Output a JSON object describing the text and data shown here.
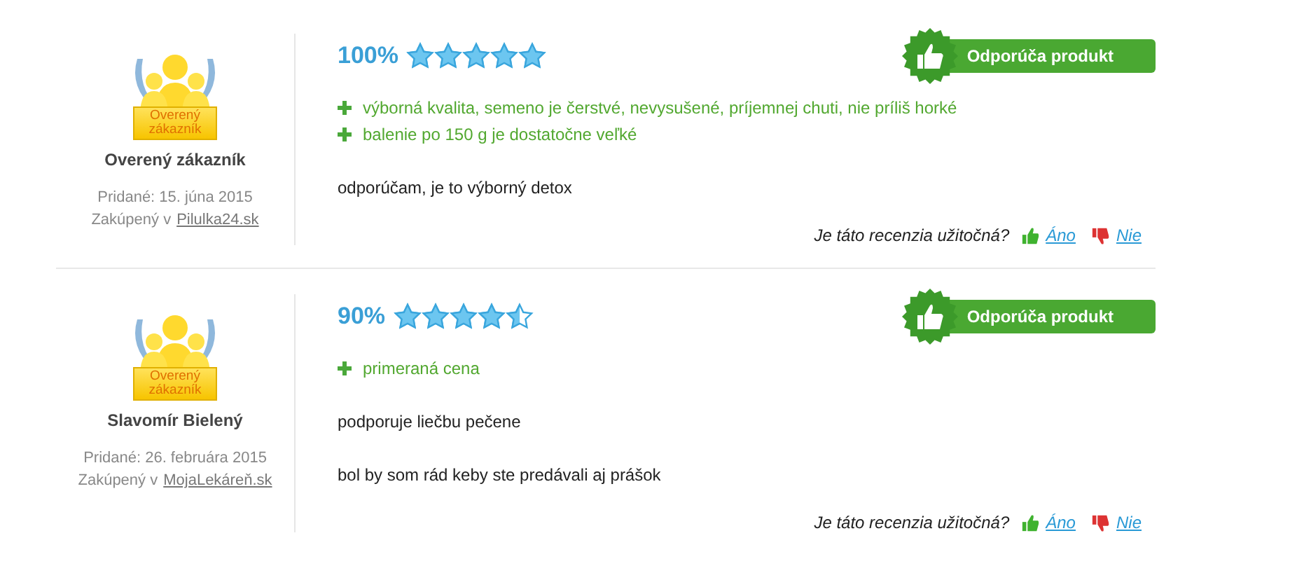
{
  "reviews": [
    {
      "badge": [
        "Overený",
        "zákazník"
      ],
      "author": "Overený zákazník",
      "added": "Pridané: 15. júna 2015",
      "purchased": "Zakúpený v",
      "shop": "Pilulka24.sk",
      "percent": "100%",
      "stars": 5,
      "recommend": "Odporúča produkt",
      "pros": [
        "výborná kvalita, semeno je čerstvé, nevysušené, príjemnej chuti, nie príliš horké",
        "balenie po 150 g je dostatočne veľké"
      ],
      "paragraphs": [
        "odporúčam, je to výborný detox"
      ],
      "helpful": "Je táto recenzia užitočná?",
      "yes": "Áno",
      "no": "Nie"
    },
    {
      "badge": [
        "Overený",
        "zákazník"
      ],
      "author": "Slavomír Bielený",
      "added": "Pridané: 26. februára 2015",
      "purchased": "Zakúpený v",
      "shop": "MojaLekáreň.sk",
      "percent": "90%",
      "stars": 4.5,
      "recommend": "Odporúča produkt",
      "pros": [
        "primeraná cena"
      ],
      "paragraphs": [
        "podporuje liečbu pečene",
        "bol by som rád keby ste predávali aj prášok"
      ],
      "helpful": "Je táto recenzia užitočná?",
      "yes": "Áno",
      "no": "Nie"
    }
  ]
}
